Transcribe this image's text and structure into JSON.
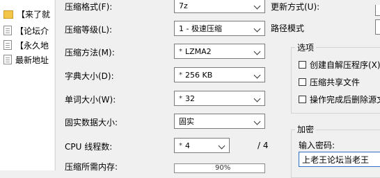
{
  "file_list": [
    {
      "name": "【来了就",
      "icon": "folder-icon"
    },
    {
      "name": "【论坛介",
      "icon": "document-icon"
    },
    {
      "name": "【永久地",
      "icon": "document-icon"
    },
    {
      "name": "最新地址",
      "icon": "document-icon"
    }
  ],
  "options": {
    "format": {
      "label": "压缩格式(F):",
      "value": "7z"
    },
    "level": {
      "label": "压缩等级(L):",
      "value": "1 - 极速压缩"
    },
    "method": {
      "label": "压缩方法(M):",
      "value": "LZMA2",
      "star": "*"
    },
    "dict_size": {
      "label": "字典大小(D):",
      "value": "256 KB",
      "star": "*"
    },
    "word_size": {
      "label": "单词大小(W):",
      "value": "32",
      "star": "*"
    },
    "solid_size": {
      "label": "固实数据大小:",
      "value": "固实"
    },
    "cpu_threads": {
      "label": "CPU 线程数:",
      "value": "4",
      "star": "*",
      "total": "/ 4"
    },
    "memory": {
      "label": "压缩所需内存:",
      "value": "90%"
    }
  },
  "right_panel": {
    "update_mode_label": "更新方式(U):",
    "path_mode_label": "路径模式",
    "options_group": {
      "title": "选项",
      "checkboxes": [
        {
          "label": "创建自解压程序(X)",
          "checked": false
        },
        {
          "label": "压缩共享文件",
          "checked": false
        },
        {
          "label": "操作完成后删除源文",
          "checked": false
        }
      ]
    },
    "encryption_group": {
      "title": "加密",
      "password_label": "输入密码:",
      "password_value": "上老王论坛当老王"
    }
  }
}
